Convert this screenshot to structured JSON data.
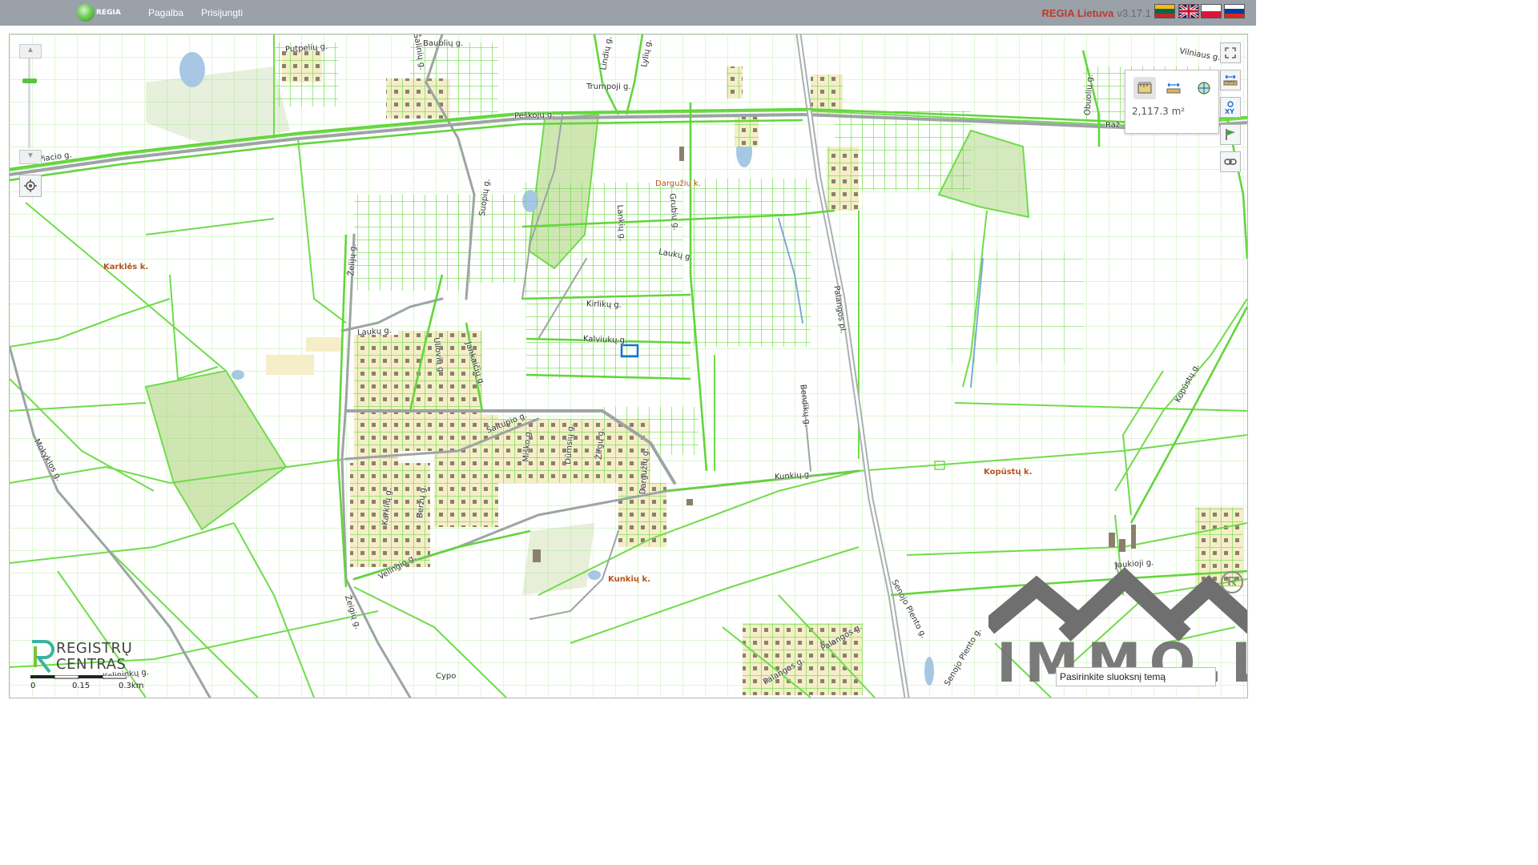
{
  "header": {
    "logo_text": "REGIA",
    "nav": {
      "help": "Pagalba",
      "login": "Prisijungti"
    },
    "app_name": "REGIA Lietuva",
    "version": "v3.17.1",
    "languages": [
      {
        "code": "lt",
        "icon": "flag-lithuania-icon"
      },
      {
        "code": "en",
        "icon": "flag-uk-icon"
      },
      {
        "code": "pl",
        "icon": "flag-poland-icon"
      },
      {
        "code": "ru",
        "icon": "flag-russia-icon"
      }
    ],
    "bar_color": "#9aa1a8",
    "app_name_color": "#c0392b"
  },
  "map": {
    "parcel_color": "#6fdc4a",
    "highlight_color": "#1a6fd6",
    "road_labels": {
      "piacio": "Piaciо g.",
      "peskoju": "Peškojų g.",
      "baubliu": "Baublių g.",
      "putpeliu": "Putpelių g.",
      "trumpoji": "Trumpoji g.",
      "lindiu": "Lindių g.",
      "lyliu": "Lylių g.",
      "saliniu": "Šalinių g.",
      "darguziu": "Dargužių k.",
      "grubiu": "Grubių g.",
      "lankiu": "Lankių g.",
      "lauku_east": "Laukų g.",
      "kirliku": "Kirlikų g.",
      "kalviuku": "Kalviukų g.",
      "suopiu": "Suopių g.",
      "zeliju": "Želijų g.",
      "lauku_west": "Laukų g.",
      "uliciu": "Uliovių g.",
      "jankaiciu": "Jankaičių g.",
      "saltupio": "Šaltupio g.",
      "misko": "Miško g.",
      "dumsiu": "Dūmsių g.",
      "zirgu": "Žirgų g.",
      "dargaziu_s": "Dargužių g.",
      "kunkiu": "Kunkių g.",
      "bendiku": "Bendikų g.",
      "palangos_pl": "Palangos pl.",
      "vilniaus": "Vilniaus g.",
      "obuoliu": "Obuolių g.",
      "raz": "Raž",
      "karkliu": "Karklių g.",
      "berzu": "Beržų g.",
      "velingio": "Velingio g.",
      "zeigiu_s": "Žeigių g.",
      "mokyklos": "Mokyklos g.",
      "senojo1": "Senojo Plento g.",
      "senojo2": "Senojo Plento g.",
      "jaukioji": "Jaukioji g.",
      "palangos1": "Palangos g.",
      "palangos2": "Palangos g.",
      "kopustu": "Kopūstų g.",
      "kelininku": "Kelininkų g.",
      "cypo": "Cypo"
    },
    "villages": {
      "karkles": "Karklės k.",
      "kunkiu": "Kunkių k.",
      "kopustu": "Kopūstų k."
    }
  },
  "controls": {
    "zoom_in": "▲",
    "zoom_out": "▼",
    "zoom_level": 0.75,
    "locate_icon": "locate-icon",
    "tools": [
      "fullscreen-icon",
      "measure-icon",
      "coordinates-xy-icon",
      "flag-marker-icon",
      "link-icon"
    ]
  },
  "measure": {
    "area_value": "2,117.3 m²",
    "tools": [
      "area-measure-icon",
      "distance-measure-icon",
      "point-icon"
    ]
  },
  "footer": {
    "rc_logo_line1": "REGISTRŲ",
    "rc_logo_line2": "CENTRAS",
    "scale_labels": [
      "0",
      "0.15",
      "0.3km"
    ],
    "layer_search_placeholder": "Pasirinkite sluoksnį temą"
  },
  "watermark": {
    "text": "IMMO.LT"
  }
}
